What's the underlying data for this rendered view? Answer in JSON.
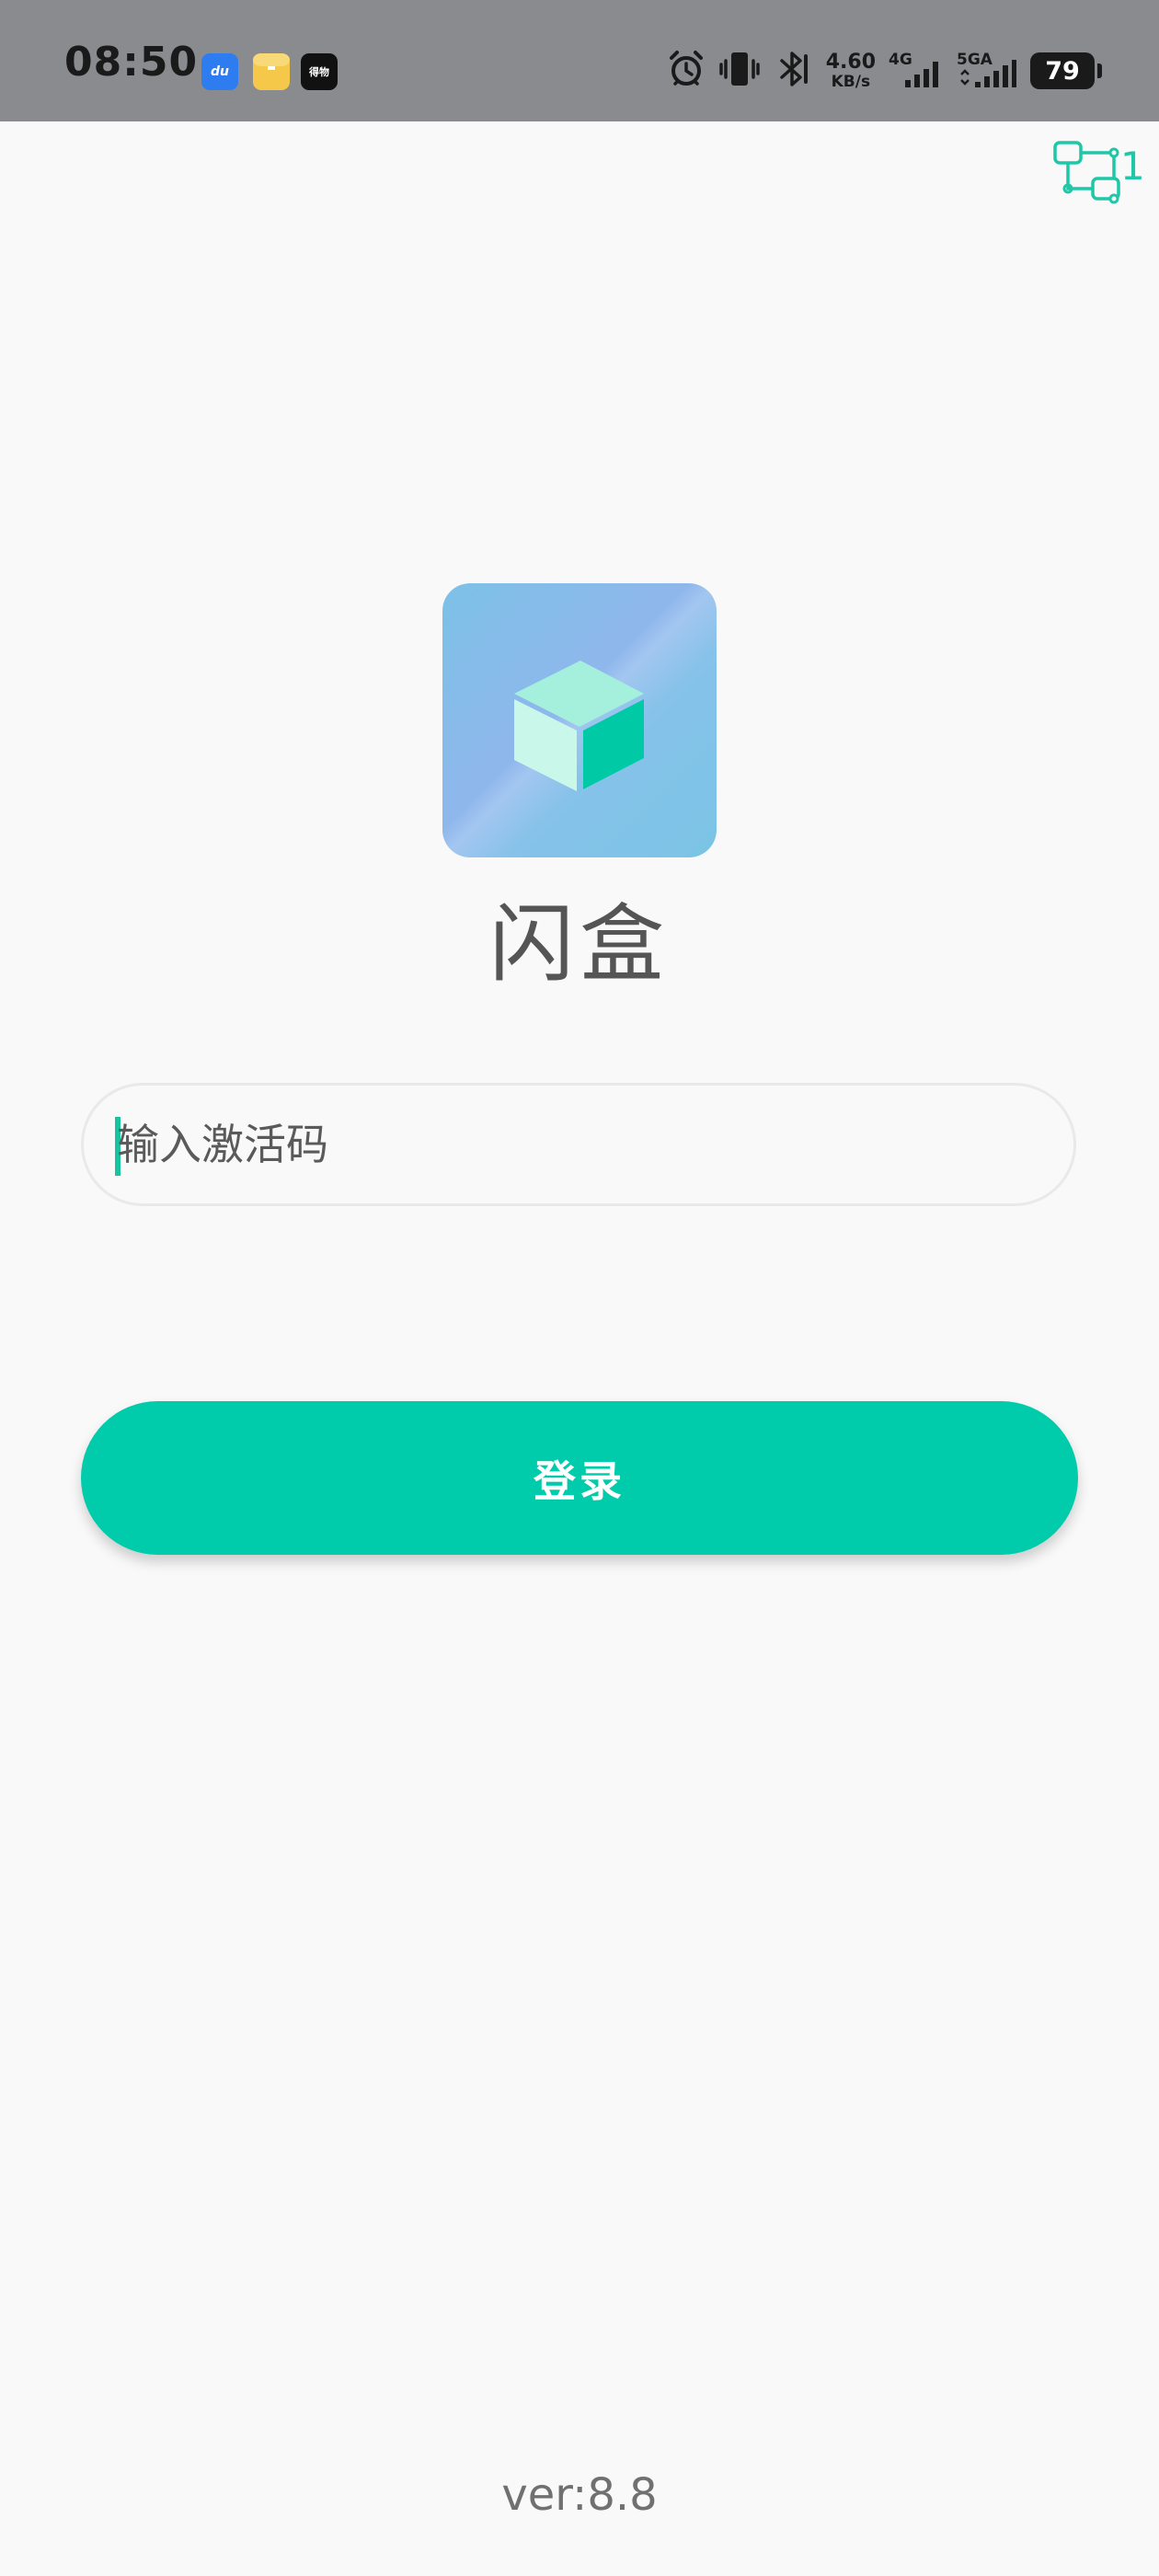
{
  "status_bar": {
    "time": "08:50",
    "app_icons": [
      "baidu-netdisk-icon",
      "notes-icon",
      "dewu-icon"
    ],
    "baidu_glyph": "du",
    "dewu_glyph": "得物",
    "net_speed_value": "4.60",
    "net_speed_unit": "KB/s",
    "sim1_label": "4G",
    "sim2_label": "5GA",
    "battery": "79"
  },
  "header": {
    "connection_count": "1"
  },
  "app": {
    "name": "闪盒"
  },
  "login": {
    "code_placeholder": "输入激活码",
    "code_value": "",
    "submit_label": "登录"
  },
  "footer": {
    "version": "ver:8.8"
  },
  "colors": {
    "accent": "#00cbab",
    "status_bar_bg": "#8a8b8f",
    "page_bg": "#f9f9f9",
    "title_text": "#555555"
  }
}
